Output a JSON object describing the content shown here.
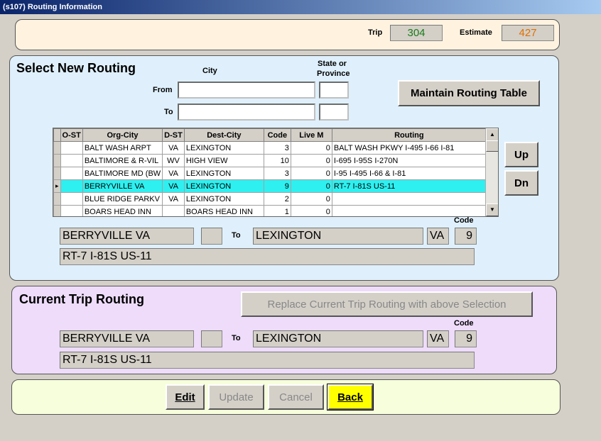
{
  "window": {
    "title": "(s107) Routing Information"
  },
  "header": {
    "trip_label": "Trip",
    "trip_value": "304",
    "estimate_label": "Estimate",
    "estimate_value": "427"
  },
  "select_routing": {
    "heading": "Select New Routing",
    "city_col": "City",
    "state_col_line1": "State or",
    "state_col_line2": "Province",
    "from_label": "From",
    "to_label": "To",
    "from_city_value": "",
    "from_state_value": "",
    "to_city_value": "",
    "to_state_value": "",
    "maintain_button": "Maintain Routing Table",
    "up_button": "Up",
    "dn_button": "Dn",
    "grid": {
      "columns": [
        "O-ST",
        "Org-City",
        "D-ST",
        "Dest-City",
        "Code",
        "Live M",
        "Routing"
      ],
      "rows": [
        [
          "",
          "BALT WASH ARPT",
          "VA",
          "LEXINGTON",
          "3",
          "0",
          "BALT WASH PKWY I-495 I-66 I-81"
        ],
        [
          "",
          "BALTIMORE & R-VIL",
          "WV",
          "HIGH VIEW",
          "10",
          "0",
          "I-695 I-95S I-270N"
        ],
        [
          "",
          "BALTIMORE MD (BW",
          "VA",
          "LEXINGTON",
          "3",
          "0",
          "I-95 I-495 I-66 & I-81"
        ],
        [
          "",
          "BERRYVILLE VA",
          "VA",
          "LEXINGTON",
          "9",
          "0",
          "RT-7 I-81S US-11"
        ],
        [
          "",
          "BLUE RIDGE PARKV",
          "VA",
          "LEXINGTON",
          "2",
          "0",
          ""
        ],
        [
          "",
          "BOARS HEAD INN",
          "",
          "BOARS HEAD INN",
          "1",
          "0",
          ""
        ]
      ],
      "selected_index": 3
    },
    "detail": {
      "org_city": "BERRYVILLE VA",
      "org_state": "",
      "to_label": "To",
      "dest_city": "LEXINGTON",
      "dest_state": "VA",
      "code_label": "Code",
      "code": "9",
      "routing": "RT-7 I-81S US-11"
    }
  },
  "current_routing": {
    "heading": "Current Trip Routing",
    "replace_button": "Replace Current Trip Routing with above Selection",
    "org_city": "BERRYVILLE VA",
    "org_state": "",
    "to_label": "To",
    "dest_city": "LEXINGTON",
    "dest_state": "VA",
    "code_label": "Code",
    "code": "9",
    "routing": "RT-7 I-81S US-11"
  },
  "actions": {
    "edit": "Edit",
    "update": "Update",
    "cancel": "Cancel",
    "back": "Back"
  },
  "colors": {
    "header_panel": "#fff3e0",
    "select_panel": "#dff0fc",
    "current_panel": "#eedcfa",
    "actions_panel": "#f6fedc",
    "selected_row": "#2ff0f0",
    "trip_value": "#1a7a1a",
    "estimate_value": "#e07000",
    "back_button": "#ffff00"
  }
}
